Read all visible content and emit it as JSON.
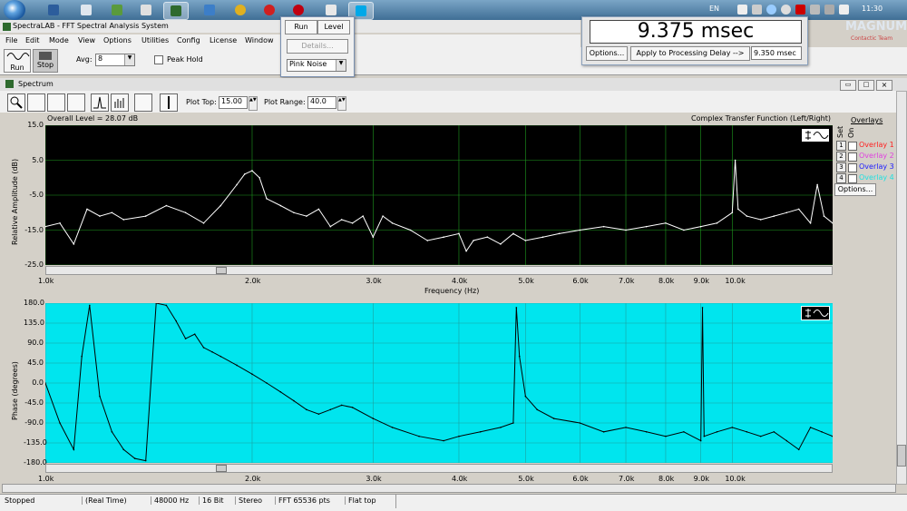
{
  "taskbar": {
    "lang": "EN",
    "clock": "11:30",
    "tray_flag_color": "#c8102e"
  },
  "window": {
    "title": "SpectraLAB - FFT Spectral Analysis System"
  },
  "menu": [
    "File",
    "Edit",
    "Mode",
    "View",
    "Options",
    "Utilities",
    "Config",
    "License",
    "Window"
  ],
  "toolbar": {
    "run_label": "Run",
    "stop_label": "Stop",
    "avg_label": "Avg:",
    "avg_value": "8",
    "peak_hold_label": "Peak Hold"
  },
  "popup": {
    "run_label": "Run",
    "level_label": "Level",
    "details_label": "Details...",
    "signal_value": "Pink Noise"
  },
  "delay": {
    "value": "9.375 msec",
    "options_label": "Options...",
    "apply_label": "Apply to Processing Delay -->",
    "processing_delay": "9.350 msec"
  },
  "watermark": "MAGNUM.LA",
  "watermark_sub": "Contactic Team",
  "spectrum": {
    "window_title": "Spectrum",
    "plot_top_label": "Plot Top:",
    "plot_top_value": "15.00",
    "plot_range_label": "Plot Range:",
    "plot_range_value": "40.0",
    "overall_level": "Overall Level = 28.07 dB",
    "function_label": "Complex Transfer Function (Left/Right)",
    "overlays": {
      "title": "Overlays",
      "set_label": "Set",
      "on_label": "On",
      "items": [
        {
          "num": "1",
          "label": "Overlay 1",
          "color": "#ff2020"
        },
        {
          "num": "2",
          "label": "Overlay 2",
          "color": "#e040e0"
        },
        {
          "num": "3",
          "label": "Overlay 3",
          "color": "#2020ff"
        },
        {
          "num": "4",
          "label": "Overlay 4",
          "color": "#20e0e0"
        }
      ],
      "options_label": "Options..."
    }
  },
  "chart_data": [
    {
      "type": "line",
      "ylabel": "Relative Amplitude (dB)",
      "xlabel": "Frequency (Hz)",
      "ylim": [
        -25,
        15
      ],
      "xlim": [
        1000,
        14000
      ],
      "x_scale": "log",
      "y_ticks": [
        "15.0",
        "5.0",
        "-5.0",
        "-15.0",
        "-25.0"
      ],
      "x_ticks": [
        "1.0k",
        "2.0k",
        "3.0k",
        "4.0k",
        "5.0k",
        "6.0k",
        "7.0k",
        "8.0k",
        "9.0k",
        "10.0k"
      ],
      "background": "#000000",
      "line_color": "#ffffff",
      "grid": true,
      "x": [
        1000,
        1050,
        1100,
        1150,
        1200,
        1250,
        1300,
        1400,
        1500,
        1600,
        1700,
        1800,
        1900,
        1950,
        2000,
        2050,
        2100,
        2200,
        2300,
        2400,
        2500,
        2600,
        2700,
        2800,
        2900,
        3000,
        3100,
        3200,
        3400,
        3600,
        3800,
        4000,
        4100,
        4200,
        4400,
        4600,
        4800,
        5000,
        5300,
        5600,
        6000,
        6500,
        7000,
        7500,
        8000,
        8500,
        9000,
        9500,
        10000,
        10100,
        10200,
        10500,
        11000,
        11500,
        12000,
        12500,
        13000,
        13300,
        13600,
        14000
      ],
      "values": [
        -14,
        -13,
        -19,
        -9,
        -11,
        -10,
        -12,
        -11,
        -8,
        -10,
        -13,
        -8,
        -2,
        1,
        2,
        0,
        -6,
        -8,
        -10,
        -11,
        -9,
        -14,
        -12,
        -13,
        -11,
        -17,
        -11,
        -13,
        -15,
        -18,
        -17,
        -16,
        -21,
        -18,
        -17,
        -19,
        -16,
        -18,
        -17,
        -16,
        -15,
        -14,
        -15,
        -14,
        -13,
        -15,
        -14,
        -13,
        -10,
        5,
        -9,
        -11,
        -12,
        -11,
        -10,
        -9,
        -13,
        -2,
        -11,
        -13
      ]
    },
    {
      "type": "line",
      "ylabel": "Phase (degrees)",
      "ylim": [
        -180,
        180
      ],
      "xlim": [
        1000,
        14000
      ],
      "x_scale": "log",
      "y_ticks": [
        "180.0",
        "135.0",
        "90.0",
        "45.0",
        "0.0",
        "-45.0",
        "-90.0",
        "-135.0",
        "-180.0"
      ],
      "x_ticks": [
        "1.0k",
        "2.0k",
        "3.0k",
        "4.0k",
        "5.0k",
        "6.0k",
        "7.0k",
        "8.0k",
        "9.0k",
        "10.0k"
      ],
      "background": "#00e5ee",
      "line_color": "#000000",
      "grid": true,
      "x": [
        1000,
        1050,
        1100,
        1130,
        1160,
        1200,
        1250,
        1300,
        1350,
        1400,
        1450,
        1500,
        1550,
        1600,
        1650,
        1700,
        1750,
        1800,
        1900,
        2000,
        2100,
        2200,
        2300,
        2400,
        2500,
        2600,
        2700,
        2800,
        3000,
        3200,
        3500,
        3800,
        4000,
        4300,
        4600,
        4800,
        4850,
        4900,
        5000,
        5200,
        5500,
        6000,
        6500,
        7000,
        7500,
        8000,
        8500,
        9000,
        9050,
        9100,
        9500,
        10000,
        10500,
        11000,
        11500,
        12000,
        12500,
        13000,
        13500,
        14000
      ],
      "values": [
        0,
        -90,
        -150,
        60,
        175,
        -30,
        -110,
        -150,
        -170,
        -175,
        180,
        175,
        140,
        100,
        110,
        80,
        70,
        60,
        40,
        20,
        0,
        -20,
        -40,
        -60,
        -70,
        -60,
        -50,
        -55,
        -80,
        -100,
        -120,
        -130,
        -120,
        -110,
        -100,
        -90,
        170,
        60,
        -30,
        -60,
        -80,
        -90,
        -110,
        -100,
        -110,
        -120,
        -110,
        -130,
        170,
        -120,
        -110,
        -100,
        -110,
        -120,
        -110,
        -130,
        -150,
        -100,
        -110,
        -120
      ]
    }
  ],
  "status": {
    "state": "Stopped",
    "mode": "(Real Time)",
    "rate": "48000 Hz",
    "bits": "16 Bit",
    "channels": "Stereo",
    "fft": "FFT 65536 pts",
    "window": "Flat top"
  }
}
